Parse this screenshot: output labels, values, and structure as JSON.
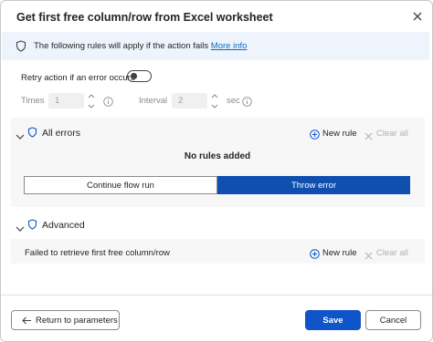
{
  "dialog": {
    "title": "Get first free column/row from Excel worksheet",
    "close_icon": "close-icon"
  },
  "info_bar": {
    "icon": "shield-icon",
    "text": "The following rules will apply if the action fails",
    "link": "More info"
  },
  "retry": {
    "label": "Retry action if an error occurs",
    "toggle_on": false,
    "times_label": "Times",
    "times_value": "1",
    "interval_label": "Interval",
    "interval_value": "2",
    "interval_unit": "sec"
  },
  "all_errors": {
    "title": "All errors",
    "new_rule": "New rule",
    "clear_all": "Clear all",
    "empty_text": "No rules added",
    "options": [
      "Continue flow run",
      "Throw error"
    ],
    "selected": "Throw error"
  },
  "advanced": {
    "title": "Advanced",
    "item_text": "Failed to retrieve first free column/row",
    "new_rule": "New rule",
    "clear_all": "Clear all"
  },
  "footer": {
    "return_label": "Return to parameters",
    "save_label": "Save",
    "cancel_label": "Cancel"
  },
  "colors": {
    "accent": "#0f54c8",
    "info_bg": "#eef4fb",
    "link": "#0f6cbd"
  }
}
